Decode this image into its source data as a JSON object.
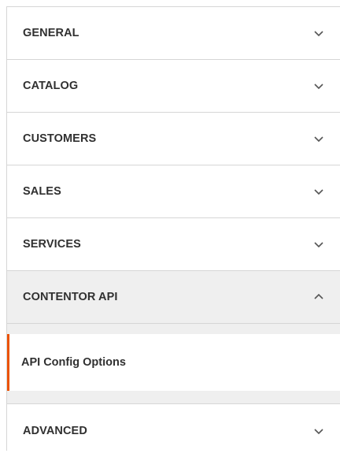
{
  "sections": [
    {
      "title": "GENERAL",
      "icon": "chevron-down-icon"
    },
    {
      "title": "CATALOG",
      "icon": "chevron-down-icon"
    },
    {
      "title": "CUSTOMERS",
      "icon": "chevron-down-icon"
    },
    {
      "title": "SALES",
      "icon": "chevron-down-icon"
    },
    {
      "title": "SERVICES",
      "icon": "chevron-down-icon"
    },
    {
      "title": "CONTENTOR API",
      "icon": "chevron-up-icon",
      "expanded": true
    },
    {
      "title": "ADVANCED",
      "icon": "chevron-down-icon"
    }
  ],
  "contentor_submenu": {
    "items": [
      {
        "label": "API Config Options",
        "active": true
      }
    ]
  },
  "colors": {
    "active_accent": "#eb5202",
    "expanded_bg": "#efefef",
    "border": "#d6d6d6",
    "text": "#303030"
  }
}
